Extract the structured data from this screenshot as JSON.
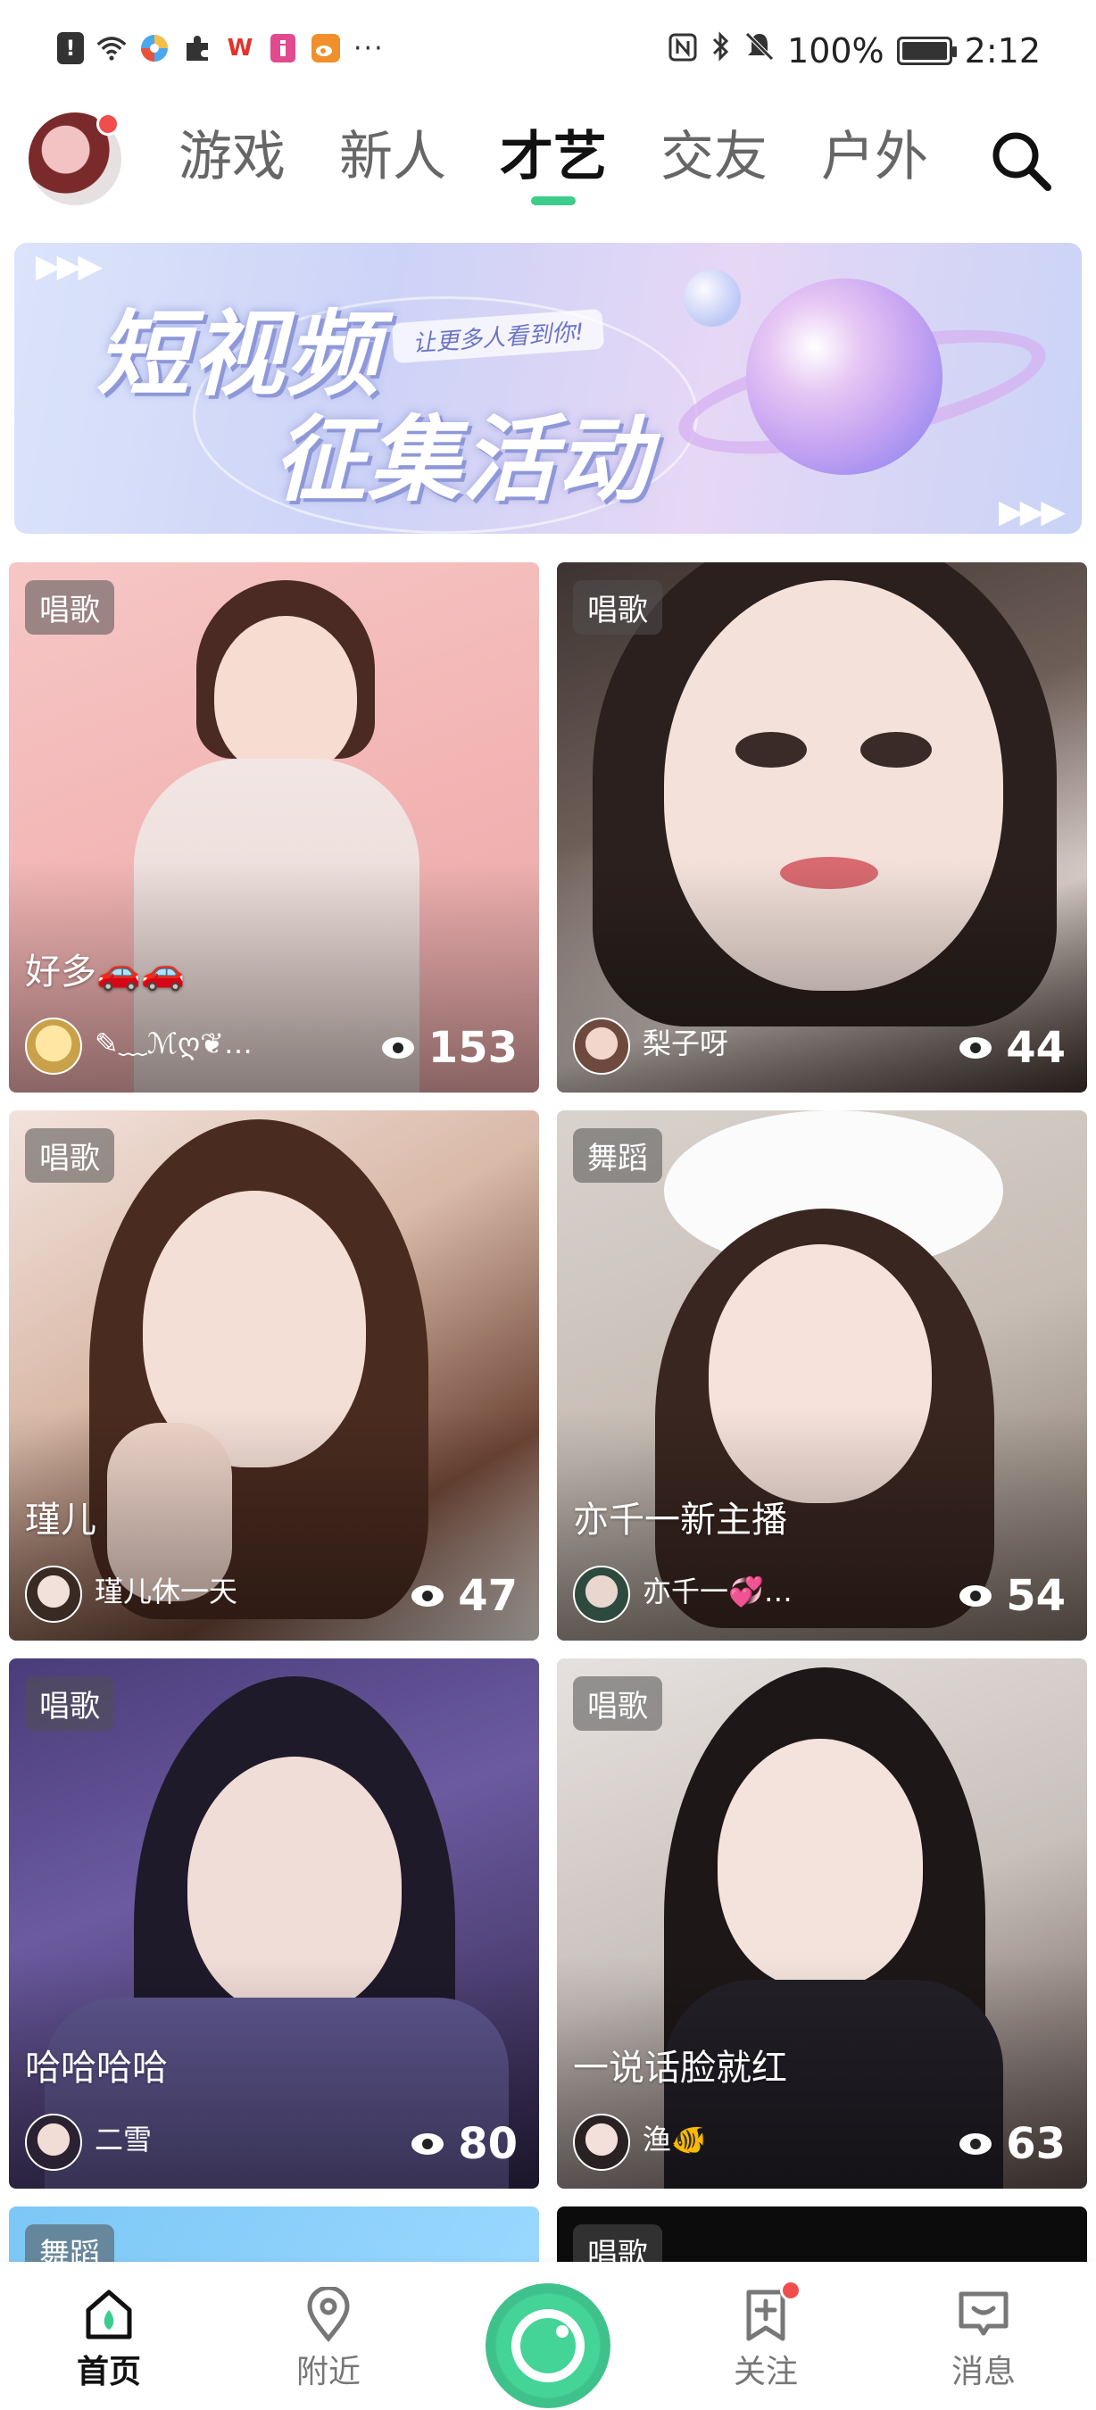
{
  "status_bar": {
    "battery_percent": "100%",
    "time": "2:12",
    "overflow": "···",
    "icons": [
      "alert-icon",
      "wifi-icon",
      "app-icon-pinwheel",
      "puzzle-icon",
      "wps-icon",
      "app-icon-i",
      "weibo-icon"
    ]
  },
  "top_nav": {
    "tabs": [
      {
        "label": "游戏"
      },
      {
        "label": "新人"
      },
      {
        "label": "才艺"
      },
      {
        "label": "交友"
      },
      {
        "label": "户外"
      }
    ],
    "active_tab": "才艺",
    "accent_color": "#3ccd8c"
  },
  "banner": {
    "title_line1": "短视频",
    "title_line2": "征集活动",
    "tagline": "让更多人看到你!",
    "arrows": "▶▶▶"
  },
  "cards": [
    {
      "tag": "唱歌",
      "title": "好多🚗🚗",
      "user": "✎﹏ℳღ❦…",
      "views": "153"
    },
    {
      "tag": "唱歌",
      "title": "",
      "user": "梨子呀",
      "views": "44"
    },
    {
      "tag": "唱歌",
      "title": "瑾儿",
      "user": "瑾儿休一天",
      "views": "47"
    },
    {
      "tag": "舞蹈",
      "title": "亦千一新主播",
      "user": "亦千一💞…",
      "views": "54"
    },
    {
      "tag": "唱歌",
      "title": "哈哈哈哈",
      "user": "二雪",
      "views": "80"
    },
    {
      "tag": "唱歌",
      "title": "一说话脸就红",
      "user": "渔🐠",
      "views": "63"
    },
    {
      "tag": "舞蹈",
      "title": "",
      "user": "",
      "views": ""
    },
    {
      "tag": "唱歌",
      "title": "",
      "user": "",
      "views": ""
    }
  ],
  "bottom_nav": {
    "items": [
      {
        "label": "首页",
        "icon": "home-icon"
      },
      {
        "label": "附近",
        "icon": "location-pin-icon"
      },
      {
        "label": "关注",
        "icon": "bookmark-plus-icon"
      },
      {
        "label": "消息",
        "icon": "message-icon"
      }
    ],
    "center_icon": "live-camera-icon",
    "badge_color": "#f24d4d"
  }
}
